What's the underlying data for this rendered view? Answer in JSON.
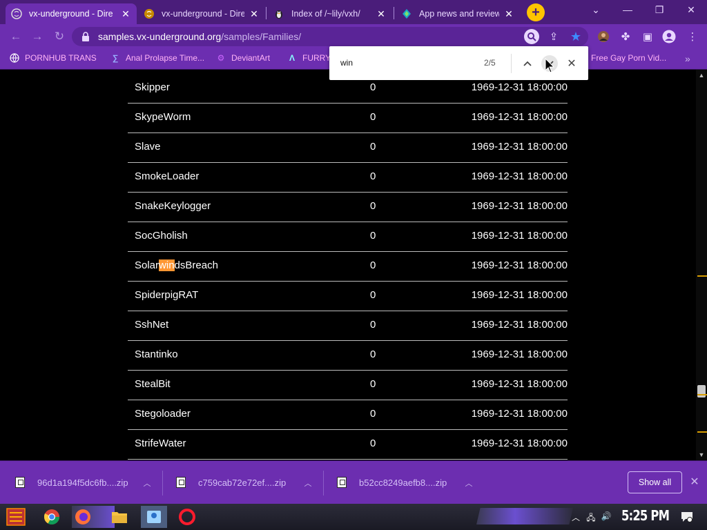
{
  "tabs": [
    {
      "title": "vx-underground - Dire",
      "active": true
    },
    {
      "title": "vx-underground - Dire",
      "active": false
    },
    {
      "title": "Index of /~lily/vxh/",
      "active": false
    },
    {
      "title": "App news and reviews",
      "active": false
    }
  ],
  "toolbar": {
    "url_host": "samples.vx-underground.org",
    "url_path": "/samples/Families/"
  },
  "bookmarks": [
    {
      "label": "PORNHUB TRANS",
      "icon": "globe-icon"
    },
    {
      "label": "Anal Prolapse Time...",
      "icon": "bracket-icon"
    },
    {
      "label": "DeviantArt",
      "icon": "gear-icon"
    },
    {
      "label": "FURRY",
      "icon": "a-logo-icon"
    },
    {
      "label": "Free Gay Porn Vid...",
      "icon": ""
    }
  ],
  "find": {
    "query": "win",
    "count": "2/5"
  },
  "files": [
    {
      "name": "Skipper",
      "size": "0",
      "date": "1969-12-31 18:00:00"
    },
    {
      "name": "SkypeWorm",
      "size": "0",
      "date": "1969-12-31 18:00:00"
    },
    {
      "name": "Slave",
      "size": "0",
      "date": "1969-12-31 18:00:00"
    },
    {
      "name": "SmokeLoader",
      "size": "0",
      "date": "1969-12-31 18:00:00"
    },
    {
      "name": "SnakeKeylogger",
      "size": "0",
      "date": "1969-12-31 18:00:00"
    },
    {
      "name": "SocGholish",
      "size": "0",
      "date": "1969-12-31 18:00:00"
    },
    {
      "name_pre": "Solar",
      "name_hl": "win",
      "name_post": "dsBreach",
      "size": "0",
      "date": "1969-12-31 18:00:00"
    },
    {
      "name": "SpiderpigRAT",
      "size": "0",
      "date": "1969-12-31 18:00:00"
    },
    {
      "name": "SshNet",
      "size": "0",
      "date": "1969-12-31 18:00:00"
    },
    {
      "name": "Stantinko",
      "size": "0",
      "date": "1969-12-31 18:00:00"
    },
    {
      "name": "StealBit",
      "size": "0",
      "date": "1969-12-31 18:00:00"
    },
    {
      "name": "Stegoloader",
      "size": "0",
      "date": "1969-12-31 18:00:00"
    },
    {
      "name": "StrifeWater",
      "size": "0",
      "date": "1969-12-31 18:00:00"
    }
  ],
  "downloads": [
    {
      "filename": "96d1a194f5dc6fb....zip"
    },
    {
      "filename": "c759cab72e72ef....zip"
    },
    {
      "filename": "b52cc8249aefb8....zip"
    }
  ],
  "shelf": {
    "show_all": "Show all"
  },
  "taskbar": {
    "clock": "5:25 PM"
  },
  "colors": {
    "accent": "#6c2eb0",
    "tab_strip": "#4a1d7a",
    "find_highlight": "#ff9632",
    "new_tab": "#ffc400"
  }
}
